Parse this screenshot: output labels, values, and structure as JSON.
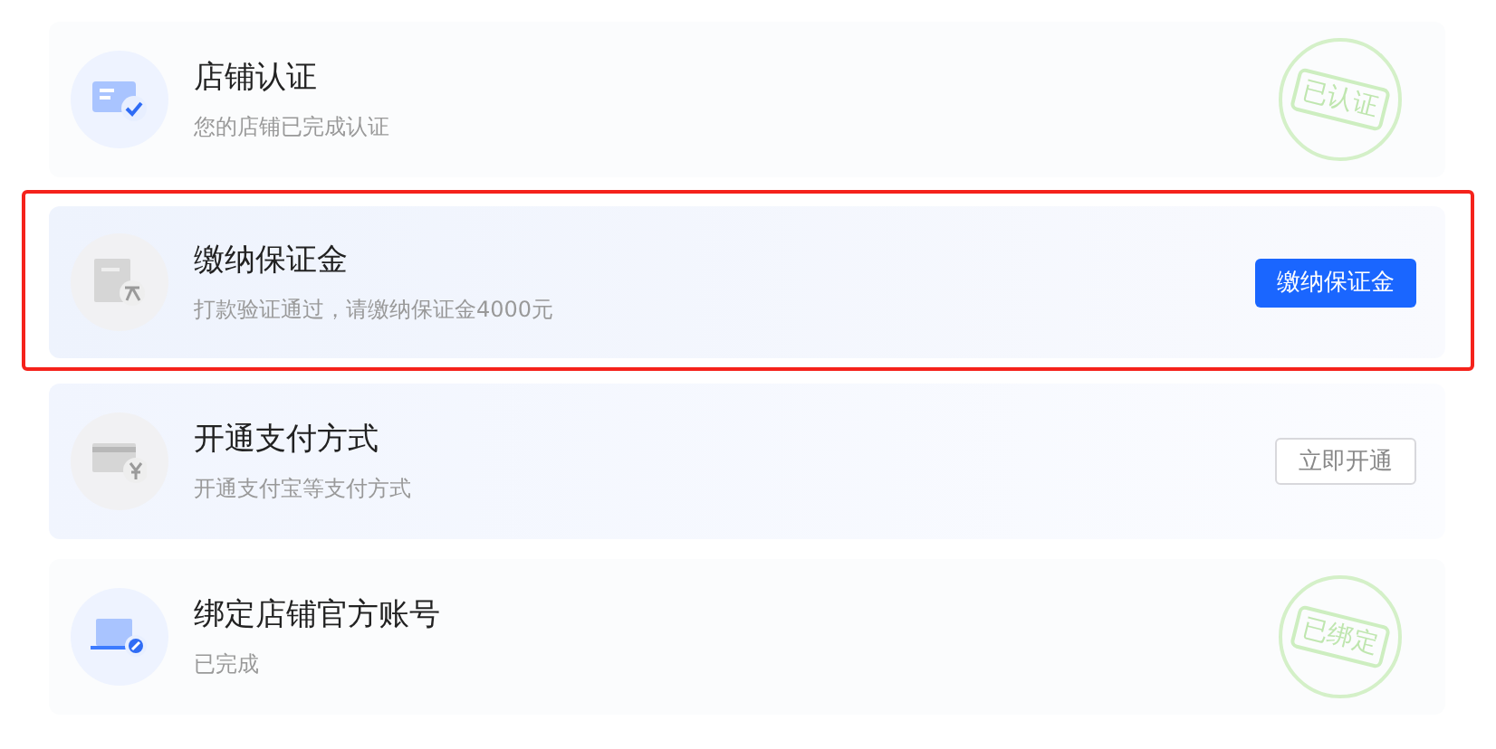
{
  "steps": [
    {
      "title": "店铺认证",
      "subtitle": "您的店铺已完成认证",
      "completed": true,
      "highlighted": false,
      "action": {
        "kind": "stamp",
        "label": "已认证"
      }
    },
    {
      "title": "缴纳保证金",
      "subtitle": "打款验证通过，请缴纳保证金4000元",
      "completed": false,
      "highlighted": true,
      "action": {
        "kind": "primary",
        "label": "缴纳保证金"
      }
    },
    {
      "title": "开通支付方式",
      "subtitle": "开通支付宝等支付方式",
      "completed": false,
      "highlighted": false,
      "action": {
        "kind": "outline",
        "label": "立即开通"
      }
    },
    {
      "title": "绑定店铺官方账号",
      "subtitle": "已完成",
      "completed": true,
      "highlighted": false,
      "action": {
        "kind": "stamp",
        "label": "已绑定"
      }
    }
  ]
}
